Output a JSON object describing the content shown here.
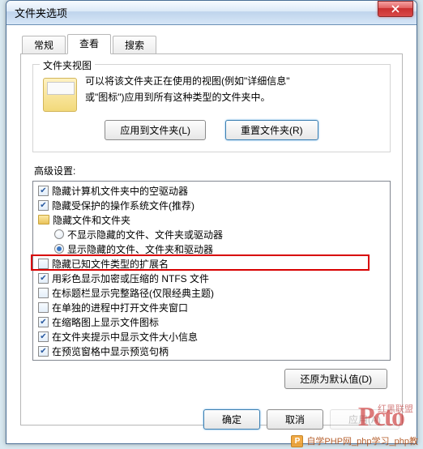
{
  "window": {
    "title": "文件夹选项"
  },
  "tabs": {
    "t0": "常规",
    "t1": "查看",
    "t2": "搜索",
    "active": 1
  },
  "folder_view": {
    "group_title": "文件夹视图",
    "desc_line1": "可以将该文件夹正在使用的视图(例如\"详细信息\"",
    "desc_line2": "或\"图标\")应用到所有这种类型的文件夹中。",
    "apply_btn": "应用到文件夹(L)",
    "reset_btn": "重置文件夹(R)"
  },
  "advanced_label": "高级设置:",
  "tree": [
    {
      "type": "checkbox",
      "checked": true,
      "indent": 0,
      "label": "隐藏计算机文件夹中的空驱动器"
    },
    {
      "type": "checkbox",
      "checked": true,
      "indent": 0,
      "label": "隐藏受保护的操作系统文件(推荐)"
    },
    {
      "type": "folder",
      "indent": 0,
      "label": "隐藏文件和文件夹"
    },
    {
      "type": "radio",
      "checked": false,
      "indent": 1,
      "label": "不显示隐藏的文件、文件夹或驱动器"
    },
    {
      "type": "radio",
      "checked": true,
      "indent": 1,
      "label": "显示隐藏的文件、文件夹和驱动器"
    },
    {
      "type": "checkbox",
      "checked": false,
      "indent": 0,
      "label": "隐藏已知文件类型的扩展名",
      "highlight": true
    },
    {
      "type": "checkbox",
      "checked": true,
      "indent": 0,
      "label": "用彩色显示加密或压缩的 NTFS 文件"
    },
    {
      "type": "checkbox",
      "checked": false,
      "indent": 0,
      "label": "在标题栏显示完整路径(仅限经典主题)"
    },
    {
      "type": "checkbox",
      "checked": false,
      "indent": 0,
      "label": "在单独的进程中打开文件夹窗口"
    },
    {
      "type": "checkbox",
      "checked": true,
      "indent": 0,
      "label": "在缩略图上显示文件图标"
    },
    {
      "type": "checkbox",
      "checked": true,
      "indent": 0,
      "label": "在文件夹提示中显示文件大小信息"
    },
    {
      "type": "checkbox",
      "checked": true,
      "indent": 0,
      "label": "在预览窗格中显示预览句柄"
    }
  ],
  "restore_defaults": "还原为默认值(D)",
  "buttons": {
    "ok": "确定",
    "cancel": "取消",
    "apply": "应用(A)"
  },
  "watermark": "自学PHP网_php学习_php教",
  "red_small": "红黑联盟"
}
